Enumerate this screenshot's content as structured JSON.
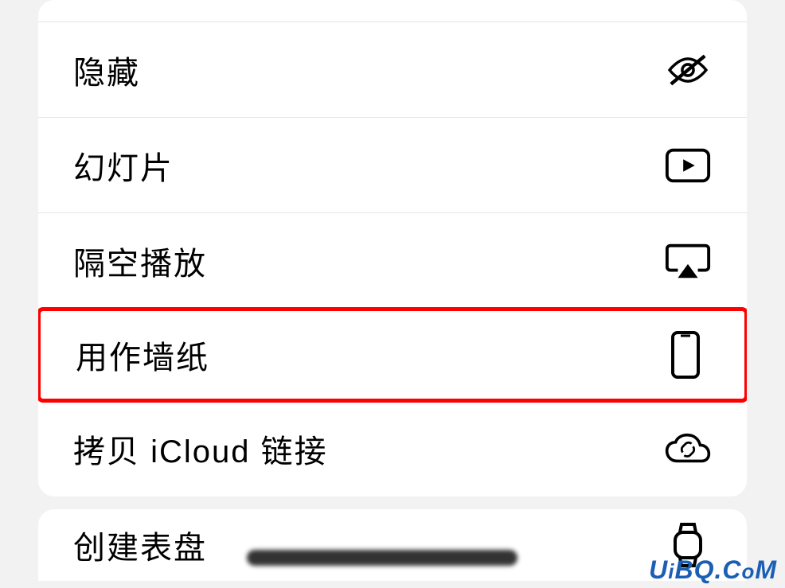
{
  "menu": {
    "items": [
      {
        "label": "隐藏",
        "icon": "eye-slash-icon"
      },
      {
        "label": "幻灯片",
        "icon": "play-rect-icon"
      },
      {
        "label": "隔空播放",
        "icon": "airplay-icon"
      },
      {
        "label": "用作墙纸",
        "icon": "phone-icon",
        "highlighted": true
      },
      {
        "label": "拷贝 iCloud 链接",
        "icon": "cloud-link-icon"
      }
    ]
  },
  "secondaryMenu": {
    "items": [
      {
        "label": "创建表盘",
        "icon": "watch-icon"
      }
    ]
  },
  "watermark": "UiBQ.CoM"
}
